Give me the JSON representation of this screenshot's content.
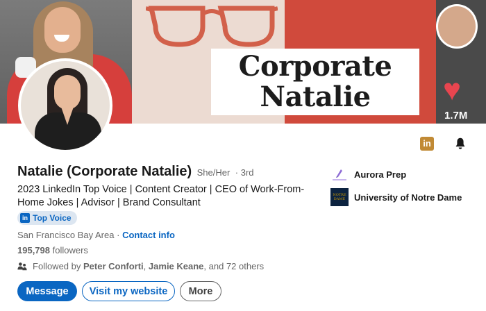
{
  "banner": {
    "title_line1": "Corporate",
    "title_line2": "Natalie",
    "video_like_count": "1.7M"
  },
  "profile": {
    "name": "Natalie (Corporate Natalie)",
    "pronouns": "She/Her",
    "connection_degree": "· 3rd",
    "headline": "2023 LinkedIn Top Voice | Content Creator | CEO of Work-From-Home Jokes | Advisor | Brand Consultant",
    "badge_label": "Top Voice",
    "location": "San Francisco Bay Area",
    "location_separator": "·",
    "contact_info_label": "Contact info",
    "followers_count": "195,798",
    "followers_label": "followers",
    "followed_by_prefix": "Followed by",
    "followed_by_person1": "Peter Conforti",
    "followed_by_separator": ",",
    "followed_by_person2": "Jamie Keane",
    "followed_by_suffix": ", and 72 others"
  },
  "actions": {
    "message_label": "Message",
    "website_label": "Visit my website",
    "more_label": "More"
  },
  "orgs": [
    {
      "name": "Aurora Prep",
      "logo_text": "Aurora Prep"
    },
    {
      "name": "University of Notre Dame",
      "logo_text": "NOTRE DAME"
    }
  ],
  "icons": {
    "linkedin_badge": "in",
    "bell": "bell-icon"
  },
  "colors": {
    "linkedin_blue": "#0a66c2",
    "banner_red": "#d04a3c",
    "badge_gold": "#c18a35",
    "nd_navy": "#0c2340"
  }
}
